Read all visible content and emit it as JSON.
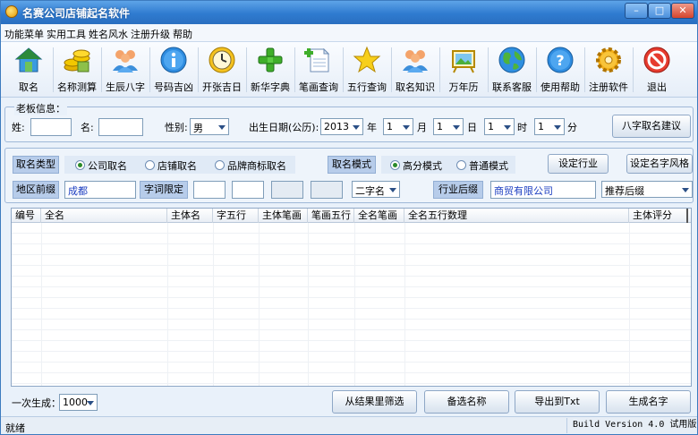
{
  "window": {
    "title": "名赛公司店铺起名软件",
    "min": "–",
    "max": "□",
    "close": "✕"
  },
  "menu": [
    "功能菜单",
    "实用工具",
    "姓名风水",
    "注册升级",
    "帮助"
  ],
  "toolbar": [
    {
      "label": "取名",
      "icon": "house-icon"
    },
    {
      "label": "名称测算",
      "icon": "coins-icon"
    },
    {
      "label": "生辰八字",
      "icon": "people-icon"
    },
    {
      "label": "号码吉凶",
      "icon": "info-icon"
    },
    {
      "label": "开张吉日",
      "icon": "clock-icon"
    },
    {
      "label": "新华字典",
      "icon": "plus-icon"
    },
    {
      "label": "笔画查询",
      "icon": "document-icon"
    },
    {
      "label": "五行查询",
      "icon": "star-icon"
    },
    {
      "label": "取名知识",
      "icon": "people-icon"
    },
    {
      "label": "万年历",
      "icon": "calendar-icon"
    },
    {
      "label": "联系客服",
      "icon": "globe-icon"
    },
    {
      "label": "使用帮助",
      "icon": "help-icon"
    },
    {
      "label": "注册软件",
      "icon": "gear-icon"
    },
    {
      "label": "退出",
      "icon": "exit-icon"
    }
  ],
  "boss": {
    "group_title": "老板信息：",
    "surname_label": "姓:",
    "surname_value": "",
    "name_label": "名:",
    "name_value": "",
    "gender_label": "性别:",
    "gender_value": "男",
    "birth_label": "出生日期(公历):",
    "year_value": "2013",
    "year_unit": "年",
    "month_value": "1",
    "month_unit": "月",
    "day_value": "1",
    "day_unit": "日",
    "hour_value": "1",
    "hour_unit": "时",
    "minute_value": "1",
    "minute_unit": "分",
    "bazi_button": "八字取名建议"
  },
  "options": {
    "type_tag": "取名类型",
    "type_company": "公司取名",
    "type_shop": "店铺取名",
    "type_brand": "品牌商标取名",
    "mode_tag": "取名模式",
    "mode_high": "高分模式",
    "mode_normal": "普通模式",
    "set_industry_button": "设定行业",
    "set_style_button": "设定名字风格",
    "region_tag": "地区前缀",
    "region_value": "成都",
    "char_tag": "字词限定",
    "char_count_value": "二字名",
    "industry_tag": "行业后缀",
    "industry_value": "商贸有限公司",
    "suffix_value": "推荐后缀"
  },
  "table": {
    "columns": [
      "编号",
      "全名",
      "主体名",
      "字五行",
      "主体笔画",
      "笔画五行",
      "全名笔画",
      "全名五行数理",
      "主体评分"
    ]
  },
  "bottom": {
    "count_label": "一次生成：",
    "count_value": "1000",
    "filter_button": "从结果里筛选",
    "candidates_button": "备选名称",
    "export_button": "导出到Txt",
    "generate_button": "生成名字"
  },
  "status": {
    "left": "就绪",
    "right": "Build Version 4.0 试用版"
  },
  "colors": {
    "titlebar": "#2f7bd0",
    "tag": "#b7ccea",
    "input_text": "#1a3cc0"
  }
}
